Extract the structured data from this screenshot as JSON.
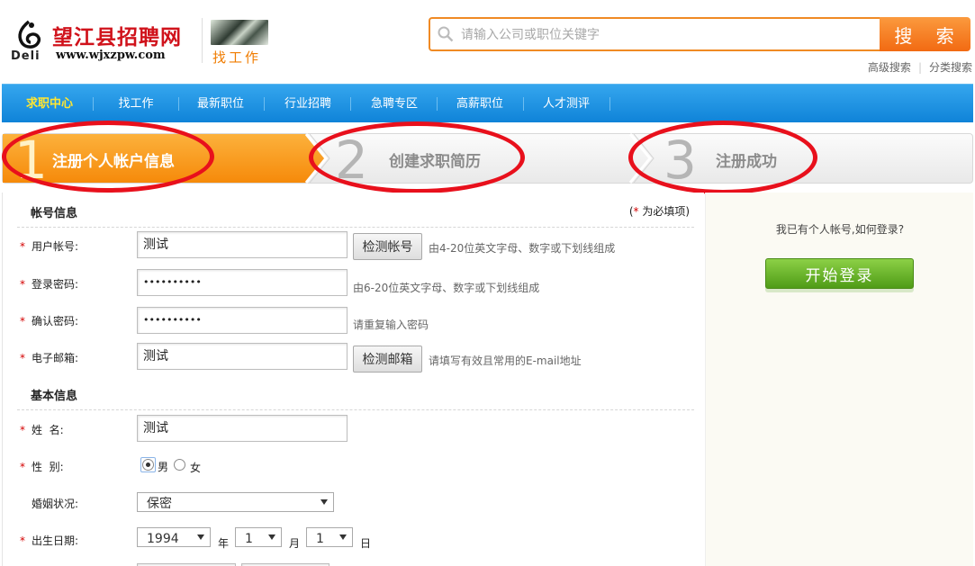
{
  "header": {
    "logo_brand": "Deli",
    "site_title": "望江县招聘网",
    "site_url": "www.wjxzpw.com",
    "findjob_label": "找工作",
    "search": {
      "placeholder": "请输入公司或职位关键字",
      "button_label": "搜 索"
    },
    "links": [
      "高级搜索",
      "分类搜索"
    ]
  },
  "nav": {
    "items": [
      {
        "label": "求职中心",
        "active": true
      },
      {
        "label": "找工作"
      },
      {
        "label": "最新职位"
      },
      {
        "label": "行业招聘"
      },
      {
        "label": "急聘专区"
      },
      {
        "label": "高薪职位"
      },
      {
        "label": "人才测评"
      }
    ]
  },
  "steps": [
    {
      "number": "1",
      "label": "注册个人帐户信息",
      "current": true
    },
    {
      "number": "2",
      "label": "创建求职简历"
    },
    {
      "number": "3",
      "label": "注册成功"
    }
  ],
  "form": {
    "account_section": "帐号信息",
    "required_note_prefix": "(",
    "required_star": "*",
    "required_note_text": " 为必填项)",
    "username": {
      "label": "用户帐号:",
      "value": "测试",
      "check_label": "检测帐号",
      "hint": "由4-20位英文字母、数字或下划线组成"
    },
    "password": {
      "label": "登录密码:",
      "value": "••••••••••",
      "hint": "由6-20位英文字母、数字或下划线组成"
    },
    "confirm_password": {
      "label": "确认密码:",
      "value": "••••••••••",
      "hint": "请重复输入密码"
    },
    "email": {
      "label": "电子邮箱:",
      "value": "测试",
      "check_label": "检测邮箱",
      "hint": "请填写有效且常用的E-mail地址"
    },
    "basic_section": "基本信息",
    "name": {
      "label": "姓  名:",
      "value": "测试"
    },
    "gender": {
      "label": "性  别:",
      "options": [
        "男",
        "女"
      ],
      "selected": "男"
    },
    "marital": {
      "label": "婚姻状况:",
      "value": "保密"
    },
    "birth": {
      "label": "出生日期:",
      "year": "1994",
      "year_unit": "年",
      "month": "1",
      "month_unit": "月",
      "day": "1",
      "day_unit": "日"
    }
  },
  "side": {
    "prompt": "我已有个人帐号,如何登录?",
    "login_button": "开始登录"
  },
  "colors": {
    "accent_orange": "#f26a12",
    "nav_blue": "#0f83d8",
    "annotation_red": "#e8101c",
    "login_green": "#4f9c17"
  }
}
